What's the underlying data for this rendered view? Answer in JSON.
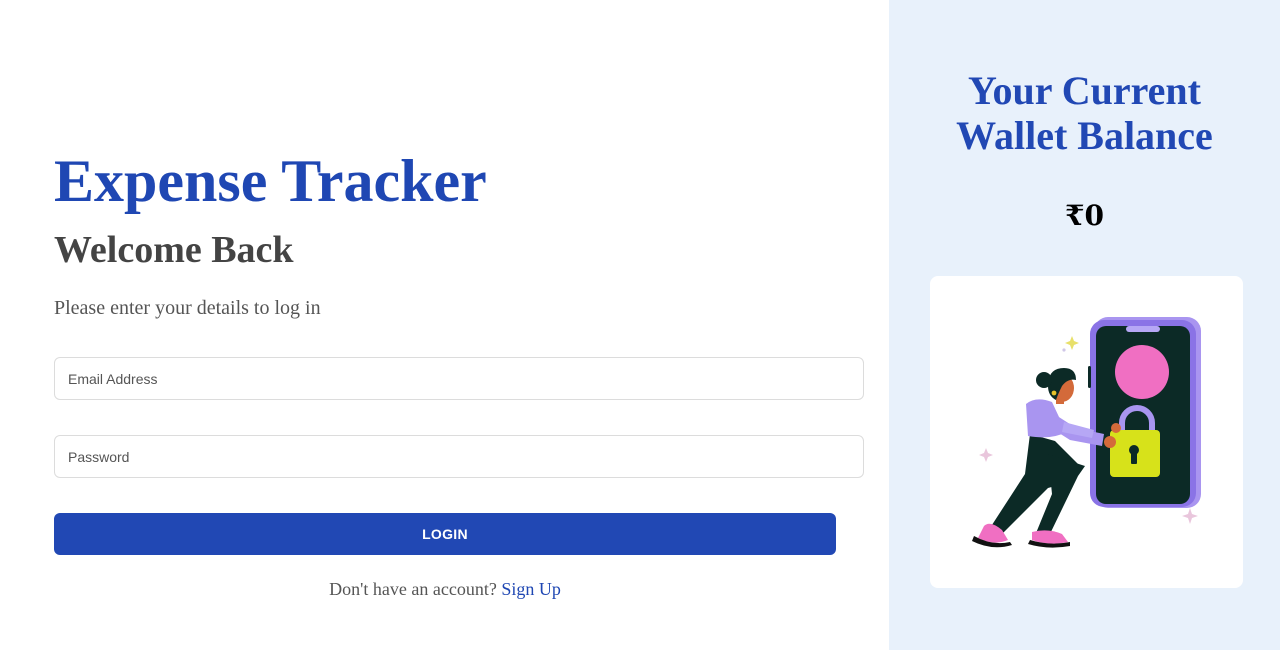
{
  "login": {
    "app_title": "Expense Tracker",
    "heading": "Welcome Back",
    "subtitle": "Please enter your details to log in",
    "email_placeholder": "Email Address",
    "password_placeholder": "Password",
    "login_label": "LOGIN",
    "signup_prompt": "Don't have an account?",
    "signup_link": "Sign Up"
  },
  "wallet": {
    "title_line1": "Your Current",
    "title_line2": "Wallet Balance",
    "balance": "₹0"
  },
  "colors": {
    "brand": "#1f47b3",
    "panel_bg": "#e8f1fb",
    "button_bg": "#2148b4"
  },
  "illustration": {
    "name": "secure-phone-illustration"
  }
}
